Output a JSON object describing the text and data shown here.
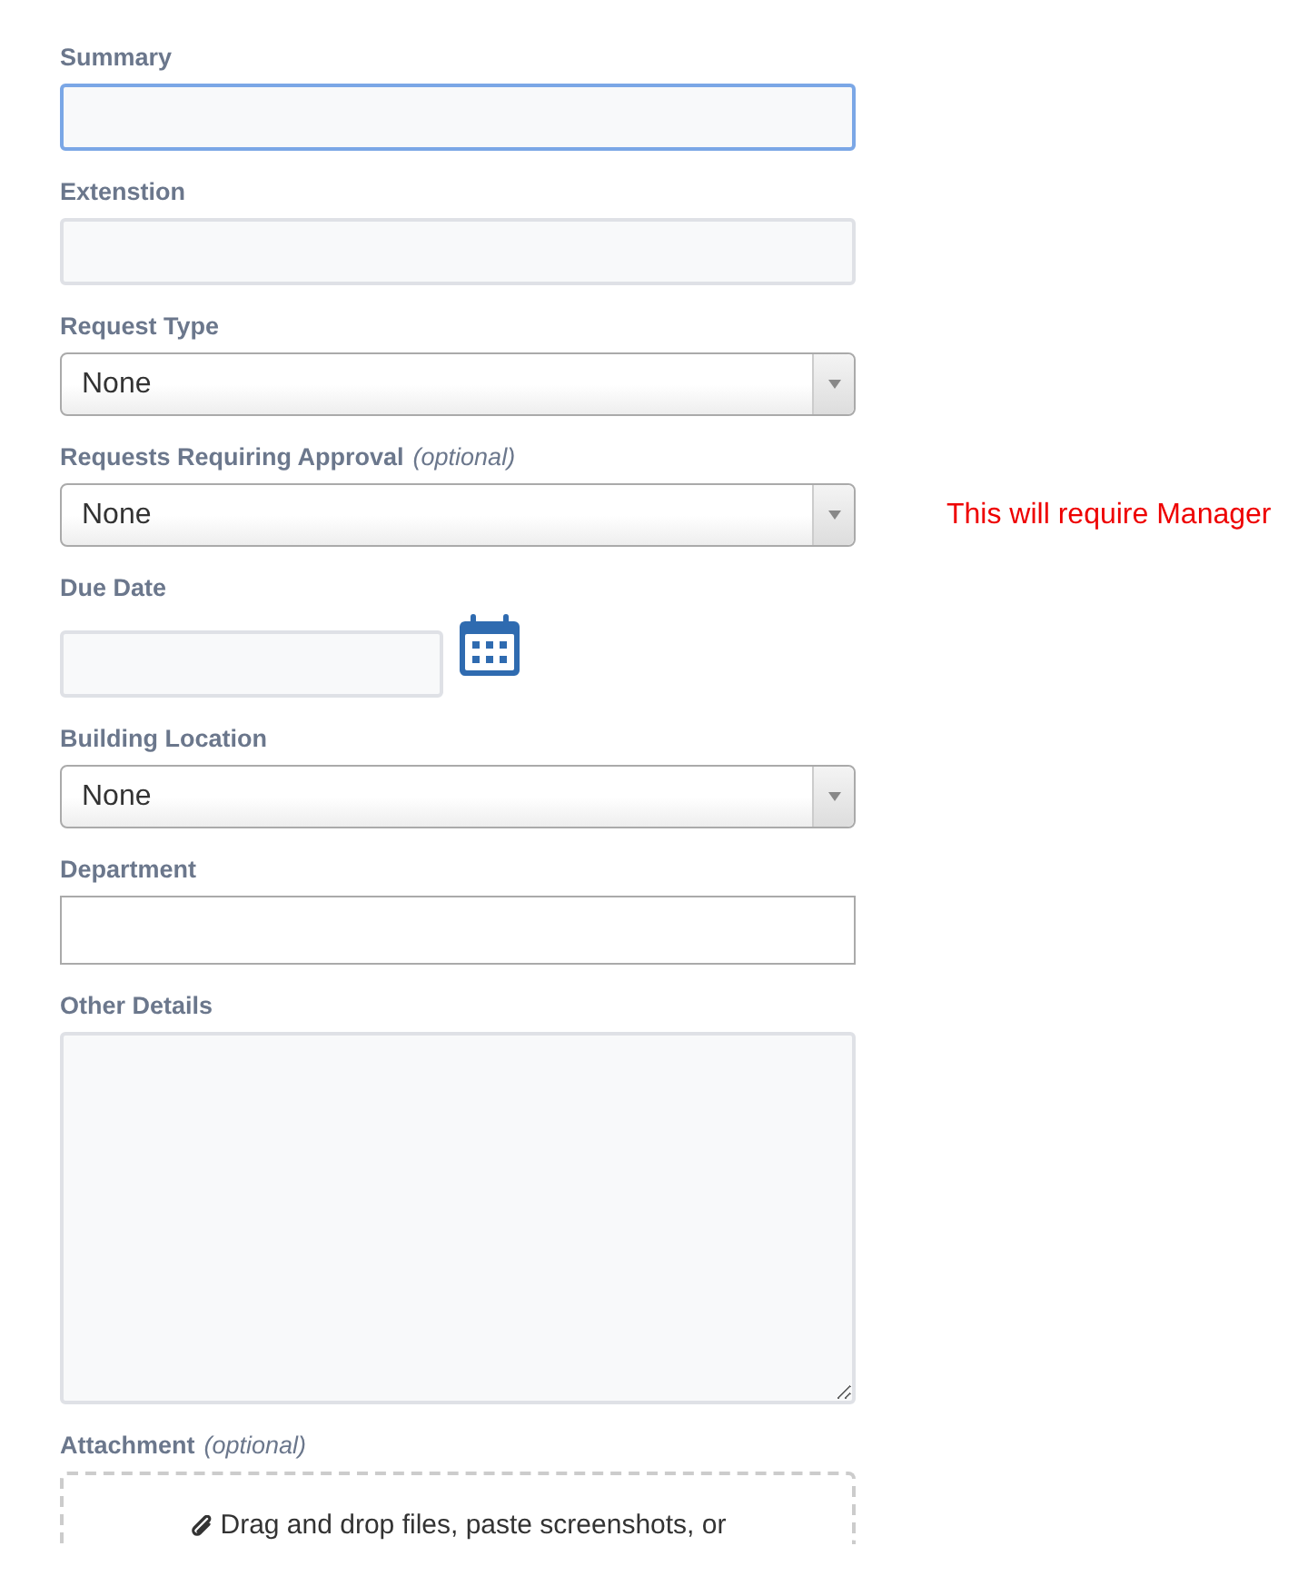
{
  "fields": [
    {
      "kind": "input",
      "label": "Summary",
      "focused": true
    },
    {
      "kind": "input",
      "label": "Extenstion",
      "focused": false
    },
    {
      "kind": "select",
      "label": "Request Type",
      "value": "None"
    },
    {
      "kind": "select",
      "label": "Requests Requiring Approval",
      "optional": "(optional)",
      "value": "None",
      "note": "This will require Manager"
    },
    {
      "kind": "date",
      "label": "Due Date"
    },
    {
      "kind": "select",
      "label": "Building Location",
      "value": "None"
    },
    {
      "kind": "plain-input",
      "label": "Department"
    },
    {
      "kind": "textarea",
      "label": "Other Details"
    },
    {
      "kind": "dropzone",
      "label": "Attachment",
      "optional": "(optional)",
      "text": "Drag and drop files, paste screenshots, or"
    }
  ]
}
